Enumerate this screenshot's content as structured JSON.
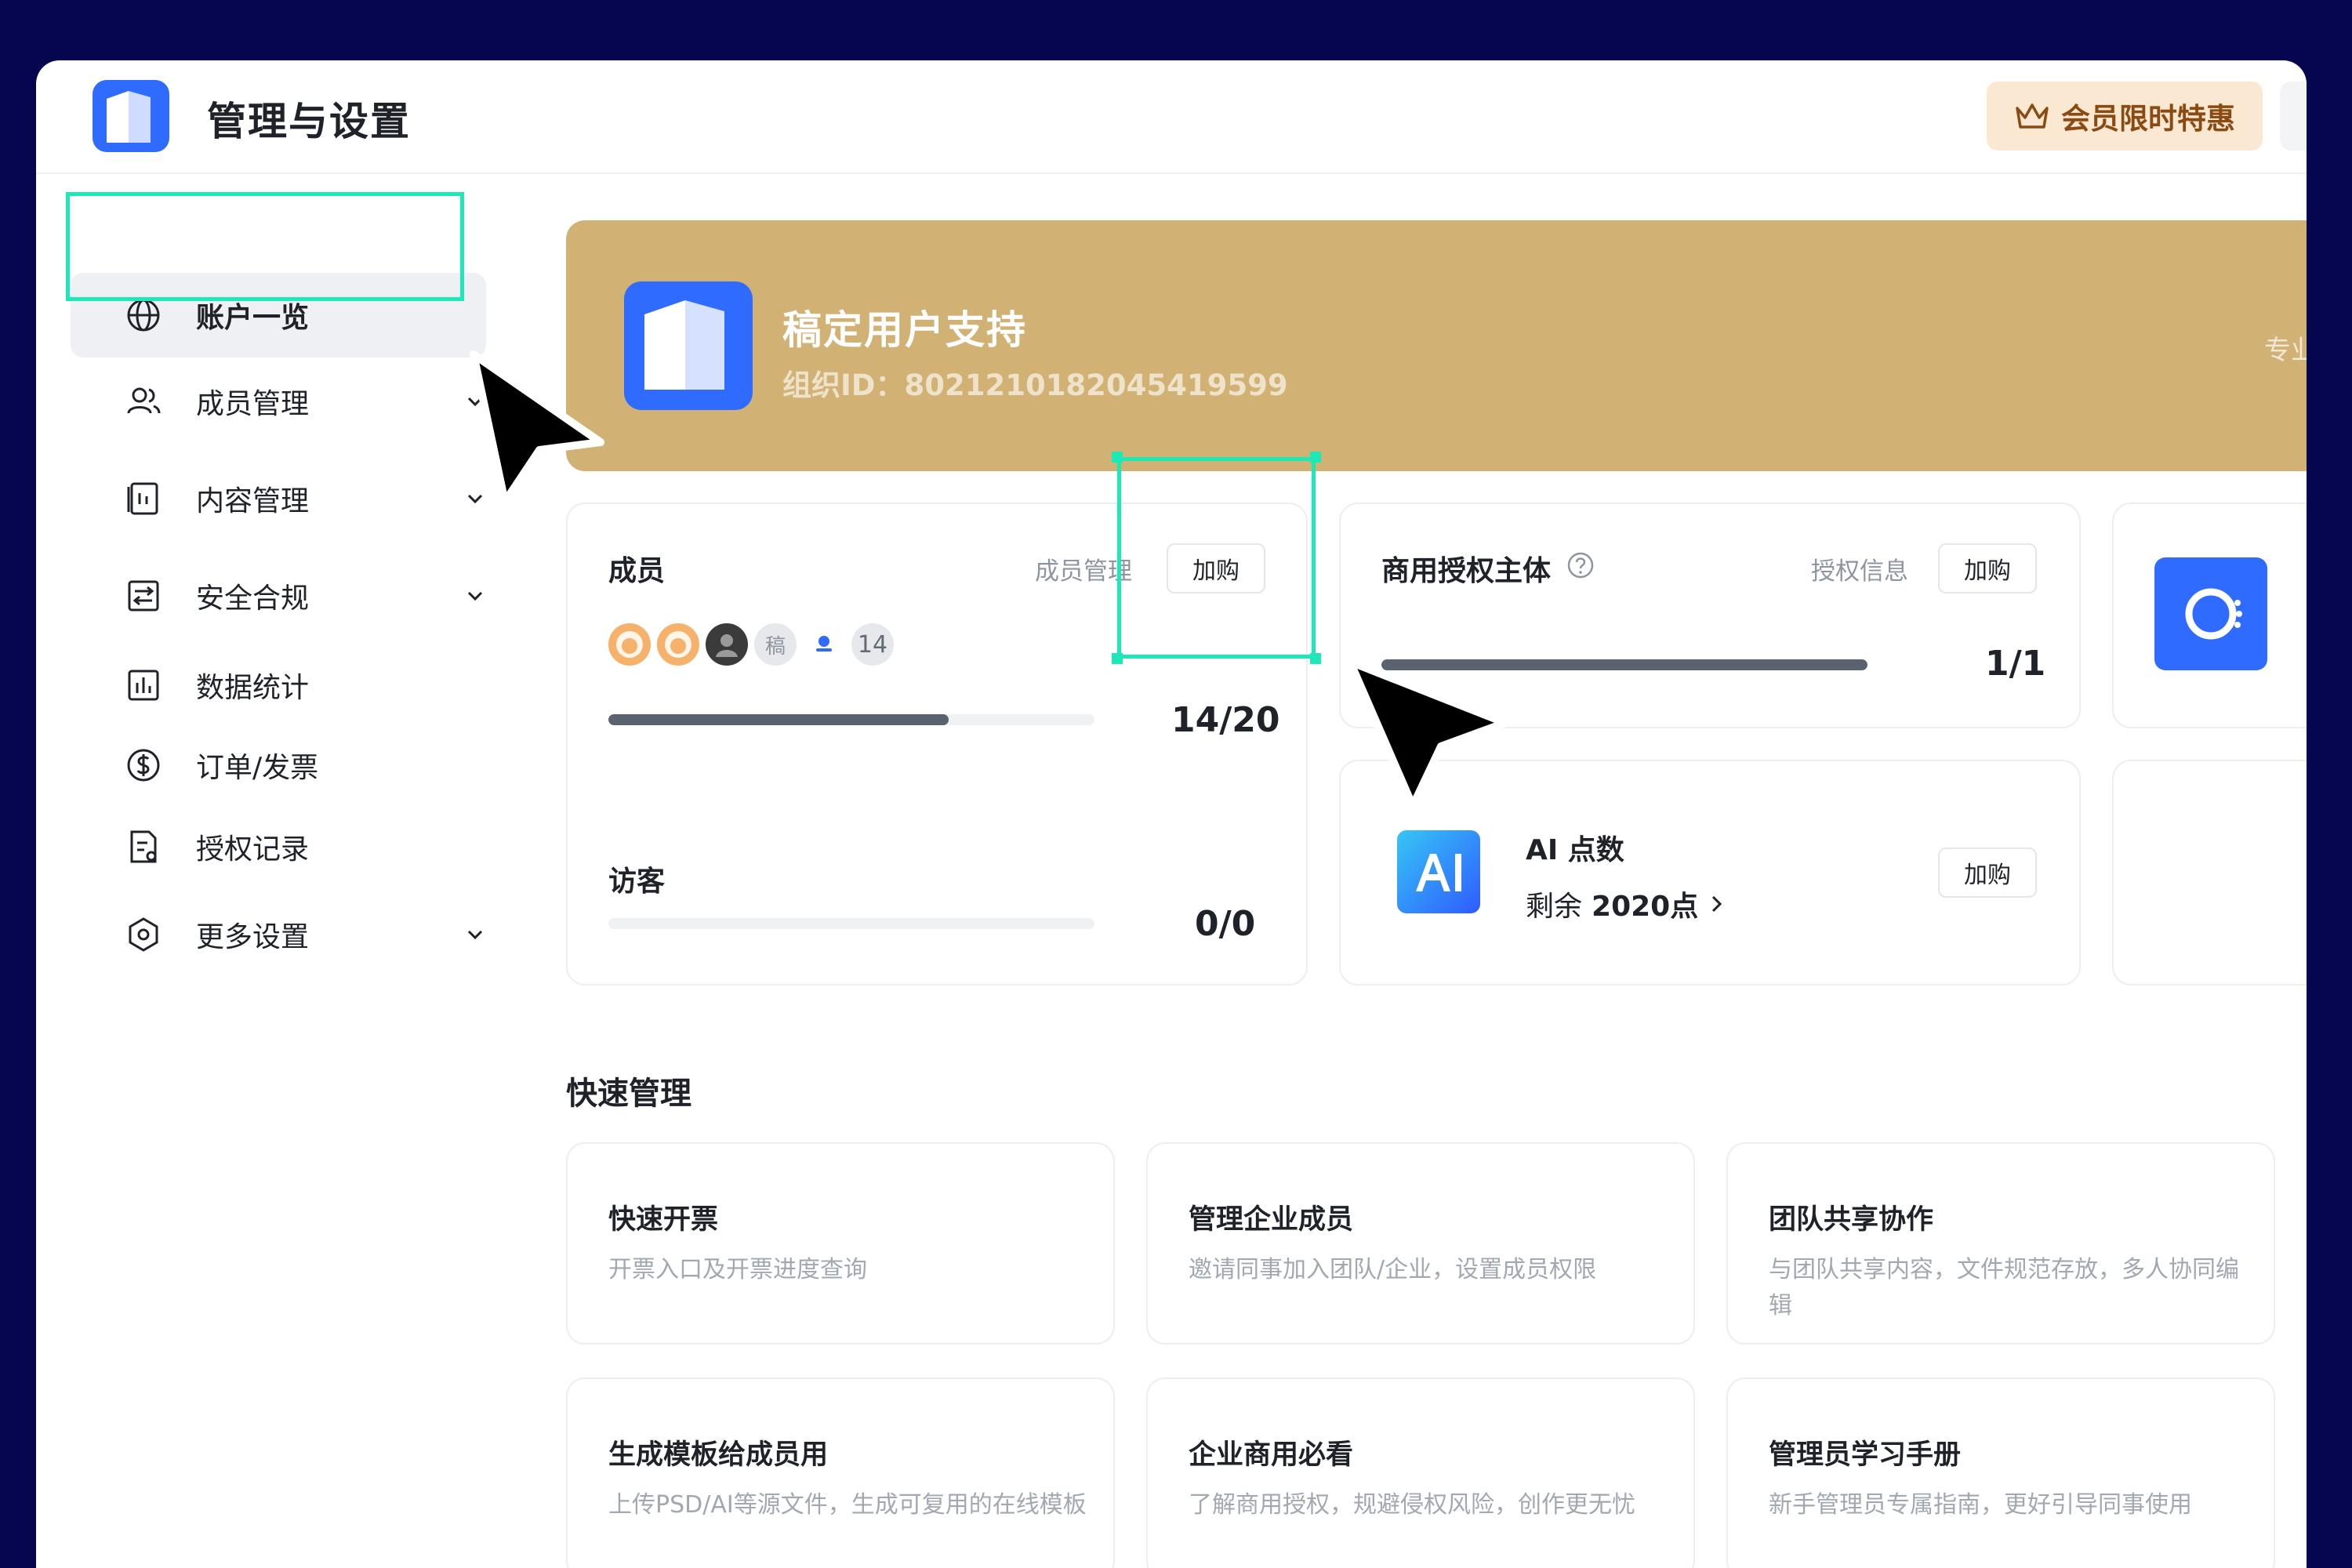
{
  "app": {
    "title": "管理与设置",
    "vip_label": "会员限时特惠"
  },
  "sidebar": {
    "items": [
      {
        "label": "账户一览",
        "icon": "globe-icon",
        "active": true
      },
      {
        "label": "成员管理",
        "icon": "users-icon",
        "expandable": true
      },
      {
        "label": "内容管理",
        "icon": "content-icon",
        "expandable": true
      },
      {
        "label": "安全合规",
        "icon": "compliance-icon",
        "expandable": true
      },
      {
        "label": "数据统计",
        "icon": "bar-chart-icon"
      },
      {
        "label": "订单/发票",
        "icon": "dollar-icon"
      },
      {
        "label": "授权记录",
        "icon": "license-record-icon"
      },
      {
        "label": "更多设置",
        "icon": "settings-icon",
        "expandable": true
      }
    ]
  },
  "org": {
    "name": "稿定用户支持",
    "id_label": "组织ID：8021210182045419599",
    "edition": "专业版"
  },
  "members_card": {
    "title": "成员",
    "manage_link": "成员管理",
    "buy_label": "加购",
    "avatar_mark": "稿",
    "avatar_overflow": "14",
    "count": "14/20",
    "progress": 0.7,
    "visitor_title": "访客",
    "visitor_count": "0/0",
    "visitor_progress": 0
  },
  "license_card": {
    "title": "商用授权主体",
    "info_link": "授权信息",
    "buy_label": "加购",
    "count": "1/1",
    "progress": 1.0
  },
  "ai_card": {
    "title": "AI 点数",
    "remain_prefix": "剩余",
    "remain_value": "2020点",
    "buy_label": "加购"
  },
  "quick": {
    "title": "快速管理",
    "cards": [
      {
        "title": "快速开票",
        "desc": "开票入口及开票进度查询"
      },
      {
        "title": "管理企业成员",
        "desc": "邀请同事加入团队/企业，设置成员权限"
      },
      {
        "title": "团队共享协作",
        "desc": "与团队共享内容，文件规范存放，多人协同编辑"
      },
      {
        "title": "生成模板给成员用",
        "desc": "上传PSD/AI等源文件，生成可复用的在线模板"
      },
      {
        "title": "企业商用必看",
        "desc": "了解商用授权，规避侵权风险，创作更无忧"
      },
      {
        "title": "管理员学习手册",
        "desc": "新手管理员专属指南，更好引导同事使用"
      }
    ]
  },
  "colors": {
    "background": "#05064f",
    "banner": "#d1b274",
    "accent": "#2f6bff",
    "highlight": "#1de9b6",
    "vip_bg": "#fbe8d3"
  }
}
